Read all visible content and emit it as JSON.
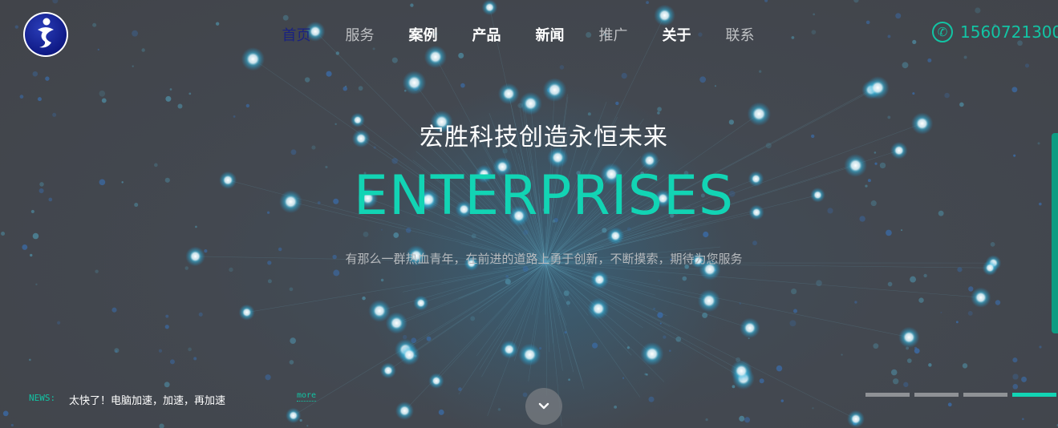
{
  "nav": {
    "items": [
      {
        "label": "首页",
        "style": "active"
      },
      {
        "label": "服务",
        "style": "dim"
      },
      {
        "label": "案例",
        "style": "bold"
      },
      {
        "label": "产品",
        "style": "bold"
      },
      {
        "label": "新闻",
        "style": "bold"
      },
      {
        "label": "推广",
        "style": "dim"
      },
      {
        "label": "关于",
        "style": "bold"
      },
      {
        "label": "联系",
        "style": "dim"
      }
    ]
  },
  "phone": {
    "icon": "phone-icon",
    "number": "1560721300"
  },
  "hero": {
    "title": "宏胜科技创造永恒未来",
    "big_text": "ENTERPRISES",
    "subtitle": "有那么一群热血青年，在前进的道路上勇于创新，不断摸索，期待为您服务"
  },
  "news": {
    "label": "NEWS:",
    "text": "太快了！电脑加速，加速，再加速",
    "more": "more"
  },
  "pager": {
    "active_index": 3,
    "count": 4
  },
  "colors": {
    "accent": "#12d4b4",
    "background": "#41444a",
    "nav_active": "#1a2280"
  }
}
